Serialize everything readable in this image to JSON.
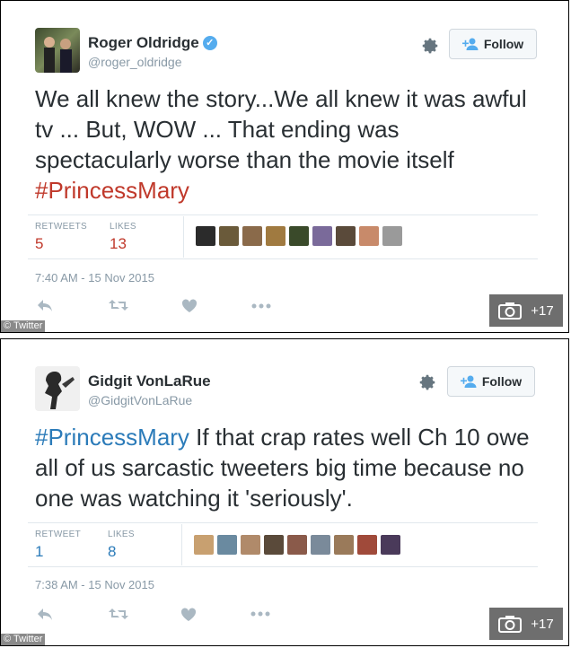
{
  "tweets": [
    {
      "name": "Roger Oldridge",
      "handle": "@roger_oldridge",
      "verified": true,
      "follow_label": "Follow",
      "text_before": "We all knew the story...We all knew it was awful tv ... But, WOW ... That ending was spectacularly worse than the movie itself ",
      "hashtag": "#PrincessMary",
      "text_after": "",
      "stat1_label": "RETWEETS",
      "stat1_value": "5",
      "stat2_label": "LIKES",
      "stat2_value": "13",
      "timestamp": "7:40 AM - 15 Nov 2015",
      "face_colors": [
        "#2b2b2b",
        "#6a5a3a",
        "#8a6a4a",
        "#a07a40",
        "#3a4a2a",
        "#7a6a9a",
        "#5a4a3a",
        "#c88a6a",
        "#9a9a9a"
      ],
      "photo_count": "+17",
      "credit": "© Twitter"
    },
    {
      "name": "Gidgit VonLaRue",
      "handle": "@GidgitVonLaRue",
      "verified": false,
      "follow_label": "Follow",
      "text_before": "",
      "hashtag": "#PrincessMary",
      "text_after": " If that crap rates well Ch 10 owe all of us sarcastic tweeters big time because no one was watching it 'seriously'.",
      "stat1_label": "RETWEET",
      "stat1_value": "1",
      "stat2_label": "LIKES",
      "stat2_value": "8",
      "timestamp": "7:38 AM - 15 Nov 2015",
      "face_colors": [
        "#c8a070",
        "#6a8aa0",
        "#b08a6a",
        "#5a4a3a",
        "#8a5a4a",
        "#7a8a9a",
        "#9a7a5a",
        "#a04a3a",
        "#4a3a5a"
      ],
      "photo_count": "+17",
      "credit": "© Twitter"
    }
  ],
  "colors": {
    "hashtag_red": "#c0392b",
    "hashtag_blue": "#2b7bb9",
    "stat_red": "#c0392b",
    "stat_blue": "#2b7bb9"
  },
  "icons": [
    "gear-icon",
    "add-user-icon",
    "reply-icon",
    "retweet-icon",
    "heart-icon",
    "more-icon",
    "camera-icon",
    "verified-icon"
  ]
}
